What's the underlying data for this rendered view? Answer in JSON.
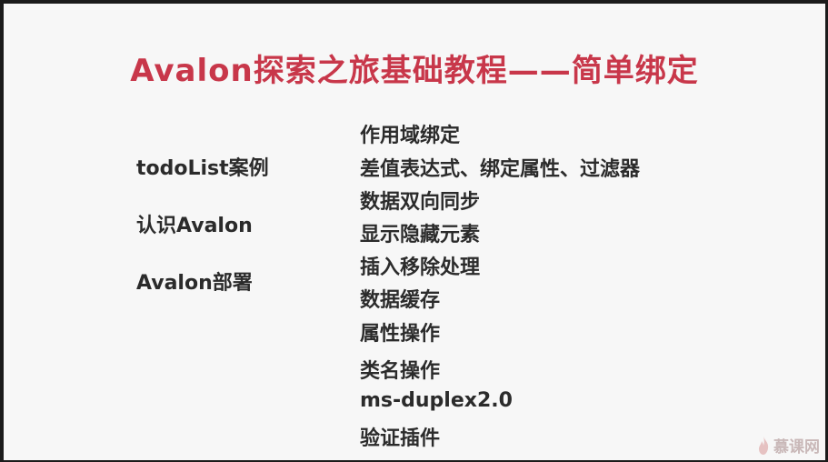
{
  "title": "Avalon探索之旅基础教程——简单绑定",
  "left_items": [
    "todoList案例",
    "认识Avalon",
    "Avalon部署"
  ],
  "right_items": [
    "作用域绑定",
    "差值表达式、绑定属性、过滤器",
    "数据双向同步",
    "显示隐藏元素",
    "插入移除处理",
    "数据缓存",
    "属性操作",
    "类名操作",
    "ms-duplex2.0",
    "验证插件"
  ],
  "watermark": {
    "icon": "flame-logo-icon",
    "text": "慕课网"
  }
}
